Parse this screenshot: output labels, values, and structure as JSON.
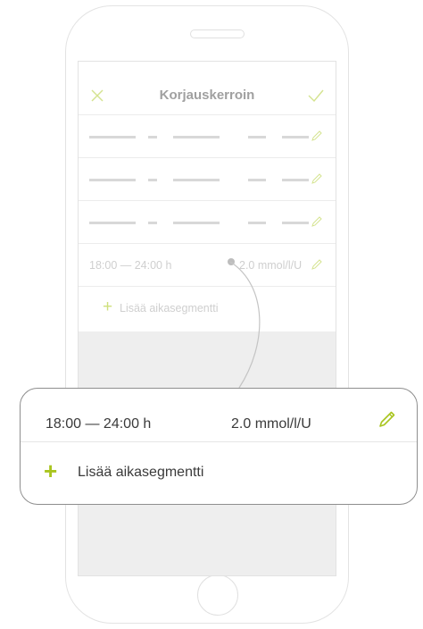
{
  "device": {
    "speaker_icon": "speaker-slot-icon",
    "home_button_icon": "home-button-icon"
  },
  "nav": {
    "title": "Korjauskerroin",
    "close_icon": "close-icon",
    "confirm_icon": "checkmark-icon"
  },
  "segments": [
    {
      "placeholder": true,
      "edit_icon": "pencil-icon"
    },
    {
      "placeholder": true,
      "edit_icon": "pencil-icon"
    },
    {
      "placeholder": true,
      "edit_icon": "pencil-icon"
    },
    {
      "time": "18:00 — 24:00 h",
      "value": "2.0 mmol/l/U",
      "edit_icon": "pencil-icon"
    }
  ],
  "add_segment": {
    "plus": "+",
    "label": "Lisää aikasegmentti"
  },
  "callout": {
    "time": "18:00 — 24:00 h",
    "value": "2.0 mmol/l/U",
    "edit_icon": "pencil-icon",
    "plus": "+",
    "add_label": "Lisää aikasegmentti"
  },
  "colors": {
    "accent": "#a9c51f",
    "accent_light": "#cfe07d",
    "text_dim": "#cfcfcf",
    "text_dark": "#3a3a3a",
    "callout_border": "#8e8e8e"
  }
}
